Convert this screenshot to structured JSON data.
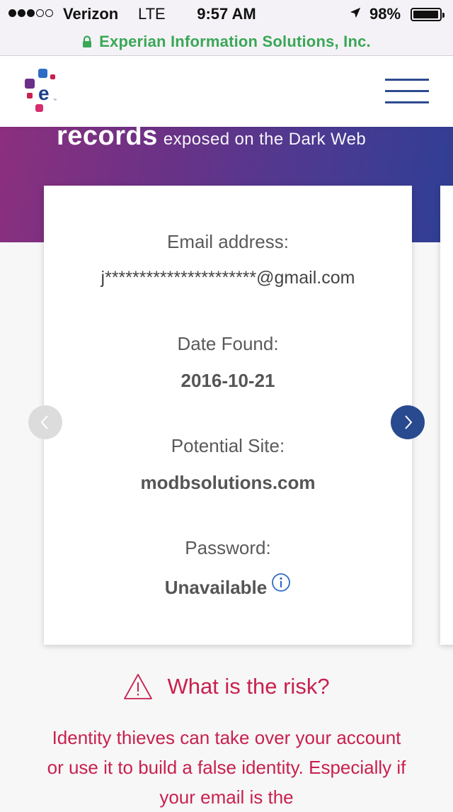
{
  "status_bar": {
    "carrier": "Verizon",
    "network": "LTE",
    "time": "9:57 AM",
    "battery_percent": "98%",
    "signal_bars_filled": 3,
    "signal_bars_total": 5,
    "battery_level": 0.98
  },
  "browser": {
    "url_label": "Experian Information Solutions, Inc.",
    "secure_icon": "lock-icon"
  },
  "header": {
    "logo_icon": "experian-logo-icon",
    "menu_icon": "hamburger-menu-icon"
  },
  "hero": {
    "bold_text": "records",
    "light_text": "exposed on the Dark Web"
  },
  "card": {
    "email_label": "Email address:",
    "email_value": "j**********************@gmail.com",
    "date_label": "Date Found:",
    "date_value": "2016-10-21",
    "site_label": "Potential Site:",
    "site_value": "modbsolutions.com",
    "password_label": "Password:",
    "password_value": "Unavailable",
    "info_icon": "info-icon"
  },
  "carousel": {
    "prev_icon": "chevron-left-icon",
    "next_icon": "chevron-right-icon"
  },
  "risk": {
    "title": "What is the risk?",
    "icon": "warning-icon",
    "body": "Identity thieves can take over your account or use it to build a false identity. Especially if your email is the"
  },
  "colors": {
    "accent_blue": "#294a8f",
    "risk_red": "#c8214d",
    "url_green": "#3aa757",
    "hero_start": "#8c2f7e",
    "hero_end": "#2e3f94"
  }
}
